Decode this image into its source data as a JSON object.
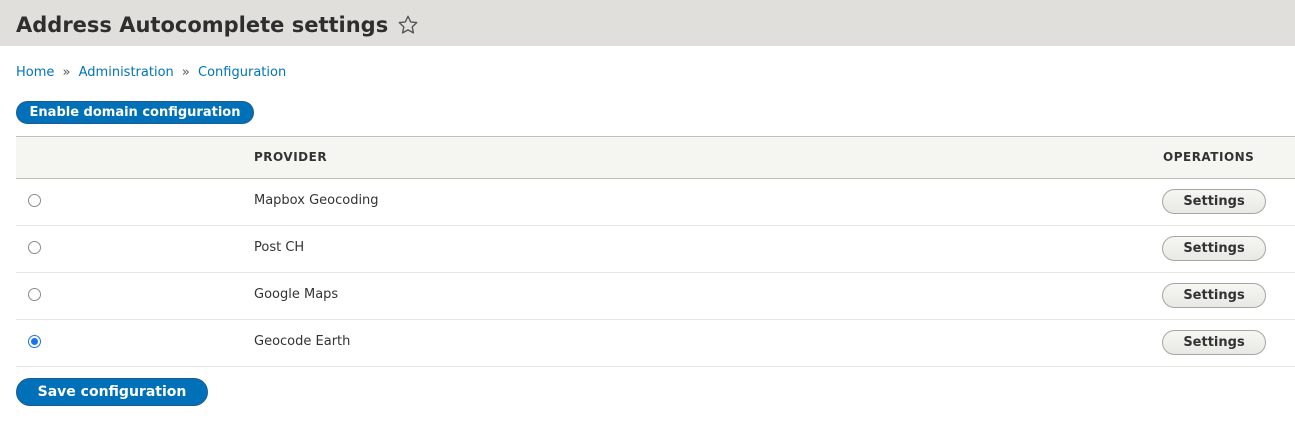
{
  "header": {
    "title": "Address Autocomplete settings",
    "star_icon": "star-outline-icon"
  },
  "breadcrumb": {
    "items": [
      "Home",
      "Administration",
      "Configuration"
    ],
    "separator": "»"
  },
  "actions": {
    "enable_domain_label": "Enable domain configuration",
    "save_label": "Save configuration"
  },
  "table": {
    "columns": [
      "",
      "PROVIDER",
      "OPERATIONS"
    ],
    "rows": [
      {
        "provider": "Mapbox Geocoding",
        "selected": false,
        "operation": "Settings"
      },
      {
        "provider": "Post CH",
        "selected": false,
        "operation": "Settings"
      },
      {
        "provider": "Google Maps",
        "selected": false,
        "operation": "Settings"
      },
      {
        "provider": "Geocode Earth",
        "selected": true,
        "operation": "Settings"
      }
    ]
  },
  "colors": {
    "header_bg": "#e0dfdb",
    "primary": "#0071b8",
    "link": "#0074bd",
    "table_header_bg": "#f5f5f2",
    "radio_checked": "#1a73e8"
  }
}
